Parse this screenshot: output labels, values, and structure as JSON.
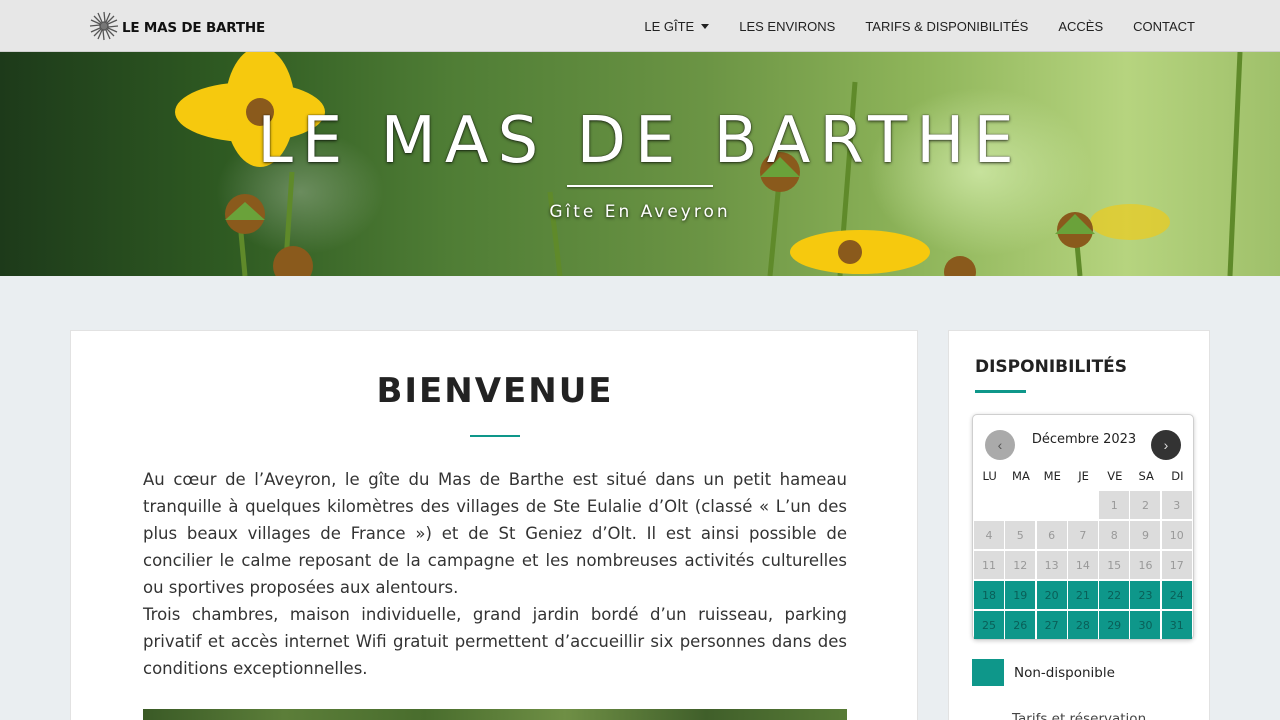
{
  "site": {
    "brand": "LE MAS DE BARTHE",
    "logo_icon": "flower-logo-icon"
  },
  "nav": {
    "items": [
      {
        "label": "LE GÎTE",
        "has_dropdown": true
      },
      {
        "label": "LES ENVIRONS"
      },
      {
        "label": "TARIFS & DISPONIBILITÉS"
      },
      {
        "label": "ACCÈS"
      },
      {
        "label": "CONTACT"
      }
    ]
  },
  "hero": {
    "title": "LE MAS DE BARTHE",
    "subtitle": "Gîte En Aveyron"
  },
  "main": {
    "title": "BIENVENUE",
    "paragraphs": [
      "Au cœur de l’Aveyron, le gîte du Mas de Barthe est situé dans un petit hameau tranquille à quelques kilomètres des villages de Ste Eulalie d’Olt (classé « L’un des plus beaux villages de France ») et de St Geniez d’Olt. Il est ainsi possible de concilier le calme reposant de la campagne et les nombreuses activités culturelles ou sportives proposées aux alentours.",
      "Trois chambres, maison individuelle, grand jardin bordé d’un ruisseau, parking privatif et accès internet Wifi gratuit permettent d’accueillir six personnes dans des conditions exceptionnelles."
    ]
  },
  "sidebar": {
    "title": "DISPONIBILITÉS",
    "calendar": {
      "month": "Décembre 2023",
      "prev": "‹",
      "next": "›",
      "weekdays": [
        "LU",
        "MA",
        "ME",
        "JE",
        "VE",
        "SA",
        "DI"
      ],
      "leading_blanks": 4,
      "days": 31,
      "unavailable_from": 18
    },
    "legend": {
      "label": "Non-disponible",
      "color": "#0e978a"
    },
    "link": "Tarifs et réservation"
  },
  "colors": {
    "accent": "#0e978a",
    "nav_bg": "#e7e7e7",
    "page_bg": "#eaeef1"
  }
}
